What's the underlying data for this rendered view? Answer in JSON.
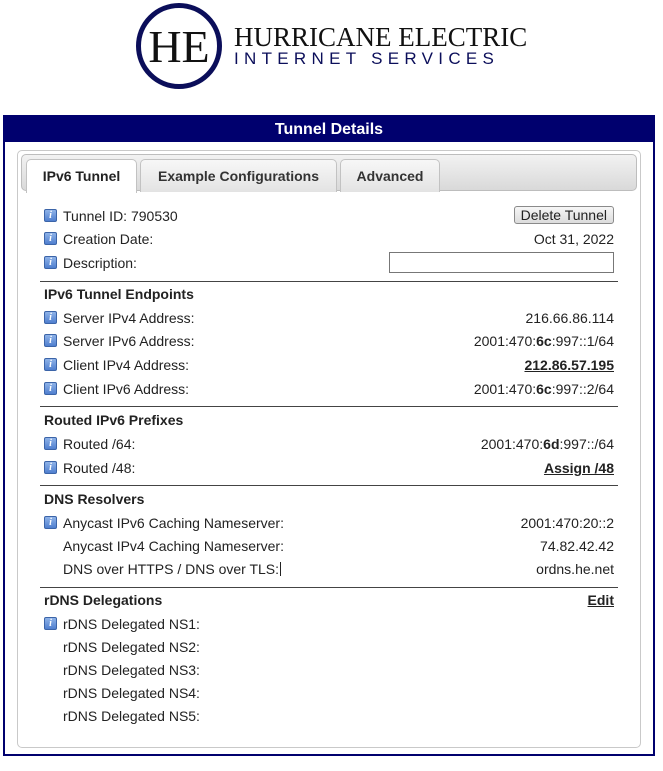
{
  "logo": {
    "line1": "HURRICANE ELECTRIC",
    "line2": "INTERNET SERVICES",
    "monogram": "HE"
  },
  "panel": {
    "title": "Tunnel Details"
  },
  "tabs": [
    "IPv6 Tunnel",
    "Example Configurations",
    "Advanced"
  ],
  "tunnel": {
    "tunnel_id_label": "Tunnel ID: 790530",
    "delete_button": "Delete Tunnel",
    "creation_date_label": "Creation Date:",
    "creation_date_value": "Oct 31, 2022",
    "description_label": "Description:",
    "description_value": ""
  },
  "endpoints": {
    "heading": "IPv6 Tunnel Endpoints",
    "server_ipv4_label": "Server IPv4 Address:",
    "server_ipv4_value": "216.66.86.114",
    "server_ipv6_label": "Server IPv6 Address:",
    "server_ipv6_pre": "2001:470:",
    "server_ipv6_bold": "6c",
    "server_ipv6_post": ":997::1/64",
    "client_ipv4_label": "Client IPv4 Address:",
    "client_ipv4_value": "212.86.57.195",
    "client_ipv6_label": "Client IPv6 Address:",
    "client_ipv6_pre": "2001:470:",
    "client_ipv6_bold": "6c",
    "client_ipv6_post": ":997::2/64"
  },
  "prefixes": {
    "heading": "Routed IPv6 Prefixes",
    "routed64_label": "Routed /64:",
    "routed64_pre": "2001:470:",
    "routed64_bold": "6d",
    "routed64_post": ":997::/64",
    "routed48_label": "Routed /48:",
    "routed48_link": "Assign /48"
  },
  "dns": {
    "heading": "DNS Resolvers",
    "anycast_v6_label": "Anycast IPv6 Caching Nameserver:",
    "anycast_v6_value": "2001:470:20::2",
    "anycast_v4_label": "Anycast IPv4 Caching Nameserver:",
    "anycast_v4_value": "74.82.42.42",
    "doh_label": "DNS over HTTPS / DNS over TLS:",
    "doh_value": "ordns.he.net"
  },
  "rdns": {
    "heading": "rDNS Delegations",
    "edit_link": "Edit",
    "ns": [
      "rDNS Delegated NS1:",
      "rDNS Delegated NS2:",
      "rDNS Delegated NS3:",
      "rDNS Delegated NS4:",
      "rDNS Delegated NS5:"
    ]
  },
  "icons": {
    "info": "info-icon",
    "info_glyph": "i"
  },
  "colors": {
    "header_bg": "#00006e",
    "logo_blue": "#0b0e5a"
  }
}
